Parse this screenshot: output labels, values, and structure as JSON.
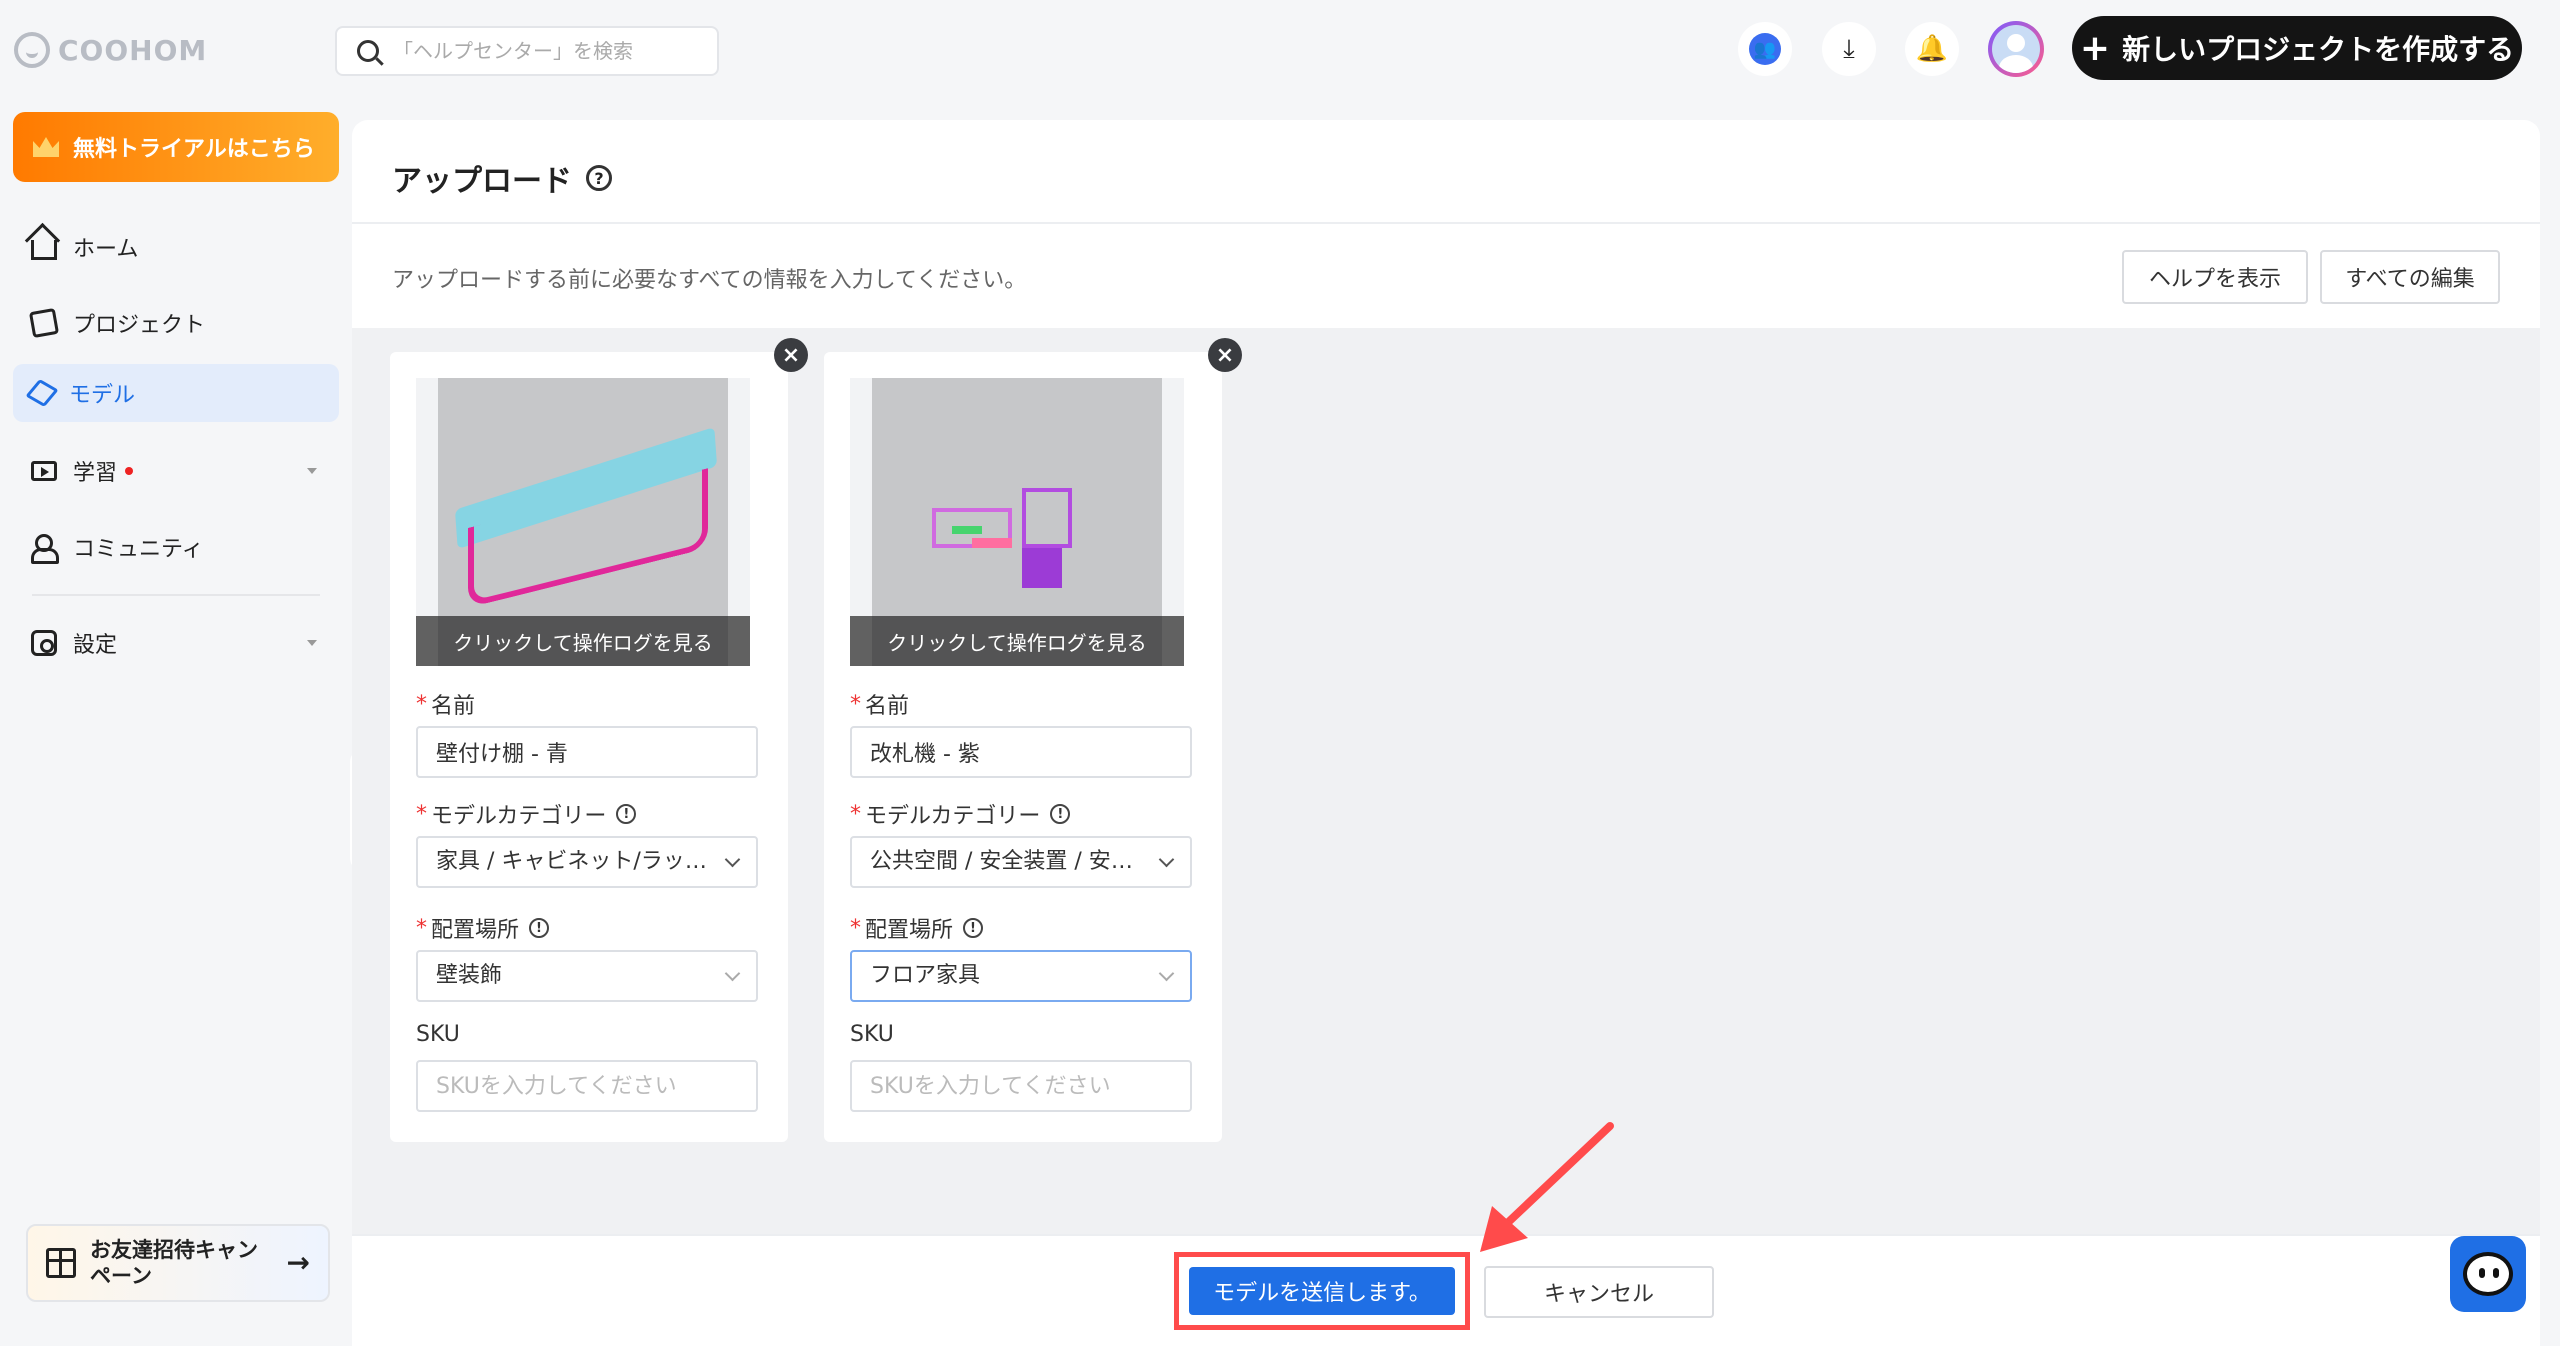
{
  "app": {
    "logo_text": "COOHOM"
  },
  "search": {
    "placeholder": "「ヘルプセンター」を検索"
  },
  "header": {
    "new_project_label": "新しいプロジェクトを作成する"
  },
  "sidebar": {
    "trial_label": "無料トライアルはこちら",
    "items": [
      {
        "label": "ホーム"
      },
      {
        "label": "プロジェクト"
      },
      {
        "label": "モデル"
      },
      {
        "label": "学習"
      },
      {
        "label": "コミュニティ"
      },
      {
        "label": "設定"
      }
    ],
    "invite_label": "お友達招待キャンペーン",
    "invite_arrow": "→"
  },
  "page": {
    "title": "アップロード",
    "instructions": "アップロードする前に必要なすべての情報を入力してください。",
    "help_button": "ヘルプを表示",
    "edit_all_button": "すべての編集"
  },
  "cards": [
    {
      "thumb_overlay": "クリックして操作ログを見る",
      "name_label": "名前",
      "name_value": "壁付け棚 - 青",
      "category_label": "モデルカテゴリー",
      "category_value": "家具 / キャビネット/ラック / 棚",
      "placement_label": "配置場所",
      "placement_value": "壁装飾",
      "sku_label": "SKU",
      "sku_placeholder": "SKUを入力してください"
    },
    {
      "thumb_overlay": "クリックして操作ログを見る",
      "name_label": "名前",
      "name_value": "改札機 - 紫",
      "category_label": "モデルカテゴリー",
      "category_value": "公共空間 / 安全装置 / 安全設備",
      "placement_label": "配置場所",
      "placement_value": "フロア家具",
      "sku_label": "SKU",
      "sku_placeholder": "SKUを入力してください"
    }
  ],
  "footer": {
    "submit_label": "モデルを送信します。",
    "cancel_label": "キャンセル"
  },
  "colors": {
    "accent": "#1f6fe5",
    "trial_gradient_start": "#ff7a00",
    "annotation": "#ff4b4b"
  }
}
